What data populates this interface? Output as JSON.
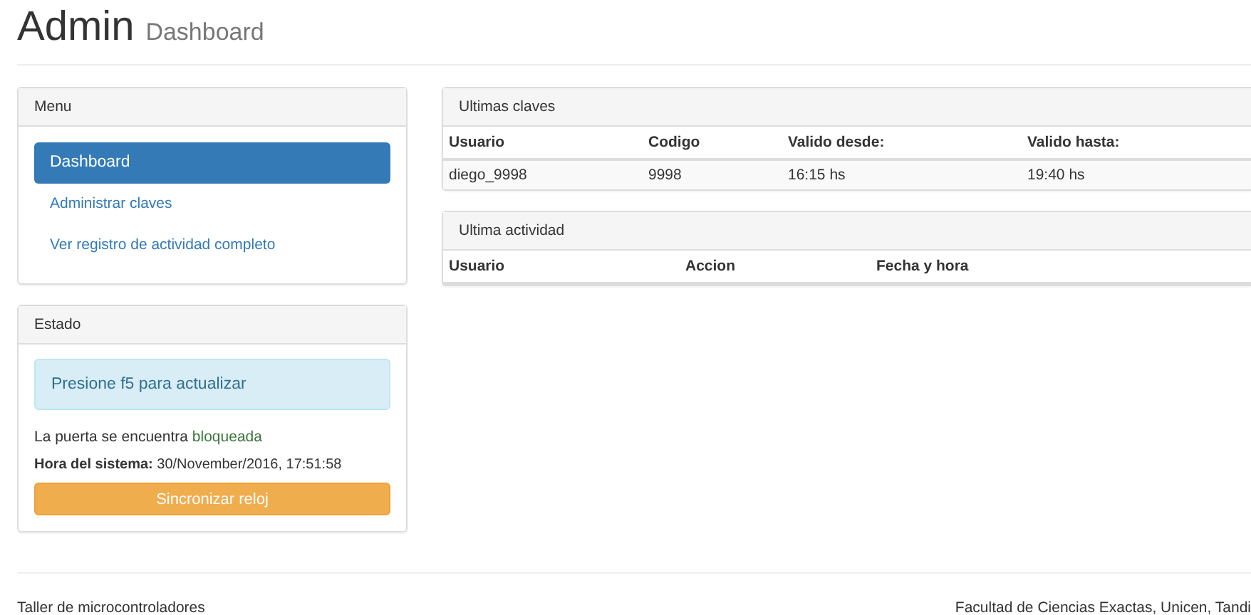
{
  "page_header": {
    "title": "Admin",
    "subtitle": "Dashboard"
  },
  "menu": {
    "title": "Menu",
    "items": [
      {
        "label": "Dashboard",
        "selected": true
      },
      {
        "label": "Administrar claves",
        "selected": false
      },
      {
        "label": "Ver registro de actividad completo",
        "selected": false
      }
    ]
  },
  "estado": {
    "title": "Estado",
    "alert": "Presione f5 para actualizar",
    "door": {
      "text": "La puerta se encuentra",
      "status": "bloqueada",
      "locked": true
    },
    "clock": {
      "label": "Hora del sistema:",
      "value": "30/November/2016, 17:51:58"
    },
    "button": "Sincronizar reloj"
  },
  "panels": [
    {
      "title": "Ultimas claves",
      "columns": [
        "Usuario",
        "Codigo",
        "Valido desde:",
        "Valido hasta:"
      ],
      "rows": [
        [
          "diego_9998",
          "9998",
          "16:15 hs",
          "19:40 hs"
        ]
      ]
    },
    {
      "title": "Ultima actividad",
      "columns": [
        "Usuario",
        "Accion",
        "Fecha y hora"
      ]
    }
  ],
  "footer": {
    "left": "Taller de microcontroladores",
    "right": "Facultad de Ciencias Exactas, Unicen, Tandi"
  }
}
